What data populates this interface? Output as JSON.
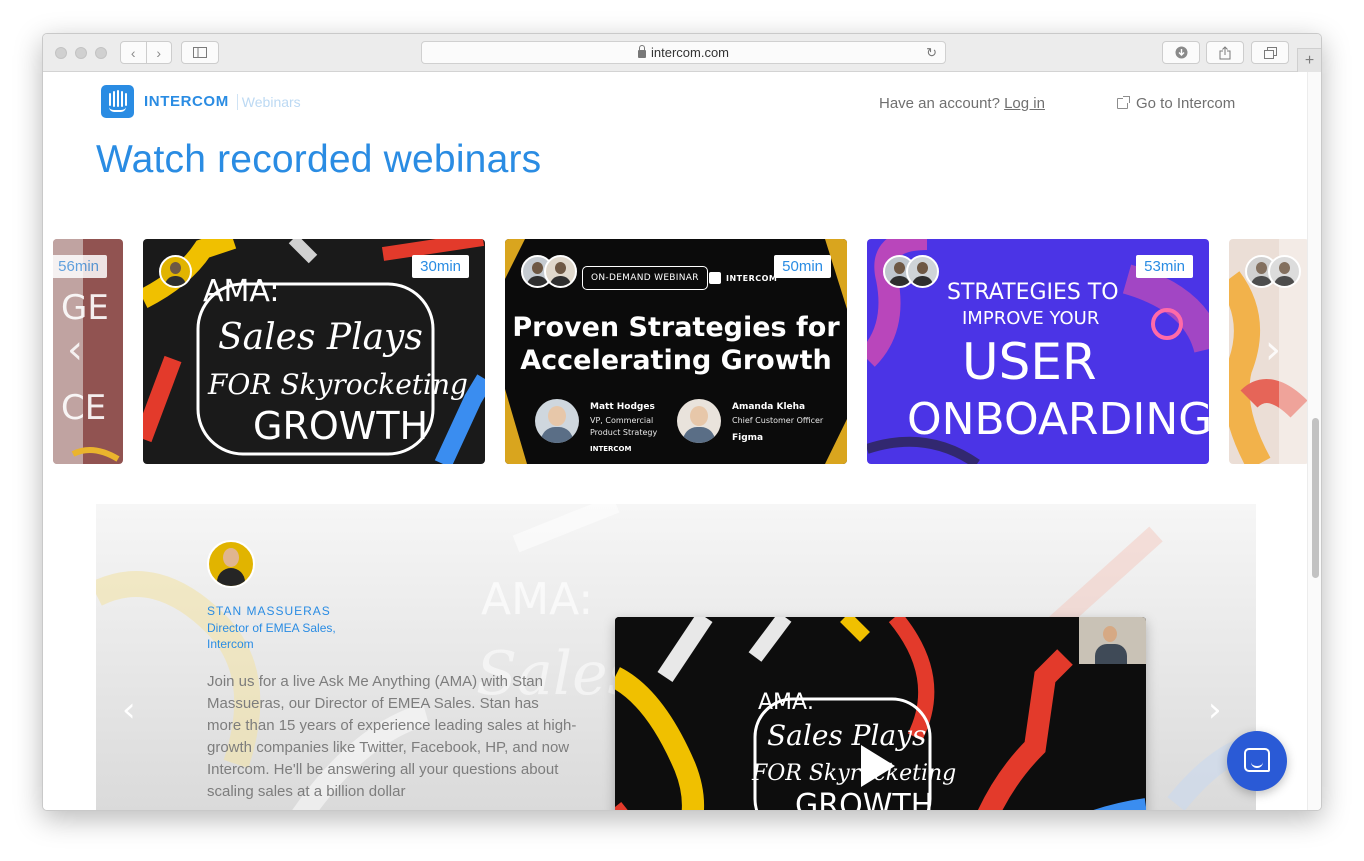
{
  "browser": {
    "url": "intercom.com",
    "back_icon": "chevron-left-icon",
    "forward_icon": "chevron-right-icon",
    "sidebar_icon": "sidebar-icon",
    "reload_icon": "reload-icon",
    "download_icon": "download-icon",
    "share_icon": "share-icon",
    "tabs_icon": "tabs-icon",
    "new_tab_label": "+"
  },
  "header": {
    "brand": "INTERCOM",
    "section": "Webinars",
    "account_prompt": "Have an account?",
    "login_label": "Log in",
    "goto_label": "Go to Intercom"
  },
  "page": {
    "title": "Watch recorded webinars"
  },
  "carousel": {
    "cards": [
      {
        "duration": "56min"
      },
      {
        "duration": "30min"
      },
      {
        "duration": "50min",
        "badge": "ON-DEMAND WEBINAR",
        "brand": "INTERCOM",
        "title": "Proven Strategies for Accelerating Growth",
        "speakers": [
          {
            "name": "Matt Hodges",
            "role": "VP, Commercial Product Strategy",
            "company": "INTERCOM"
          },
          {
            "name": "Amanda Kleha",
            "role": "Chief Customer Officer",
            "company": "Figma"
          }
        ]
      },
      {
        "duration": "53min"
      },
      {
        "duration": ""
      }
    ],
    "prev_icon": "chevron-left-icon",
    "next_icon": "chevron-right-icon"
  },
  "featured": {
    "speaker_name": "STAN MASSUERAS",
    "speaker_role": "Director of EMEA Sales, Intercom",
    "description": "Join us for a live Ask Me Anything (AMA) with Stan Massueras, our Director of EMEA Sales. Stan has more than 15 years of experience leading sales at high-growth companies like Twitter, Facebook, HP, and now Intercom. He'll be answering all your questions about scaling sales at a billion dollar",
    "play_icon": "play-icon"
  },
  "chat": {
    "icon": "chat-bubble-icon"
  },
  "colors": {
    "brand_blue": "#2a8ce3",
    "chat_blue": "#2a5ad6"
  }
}
